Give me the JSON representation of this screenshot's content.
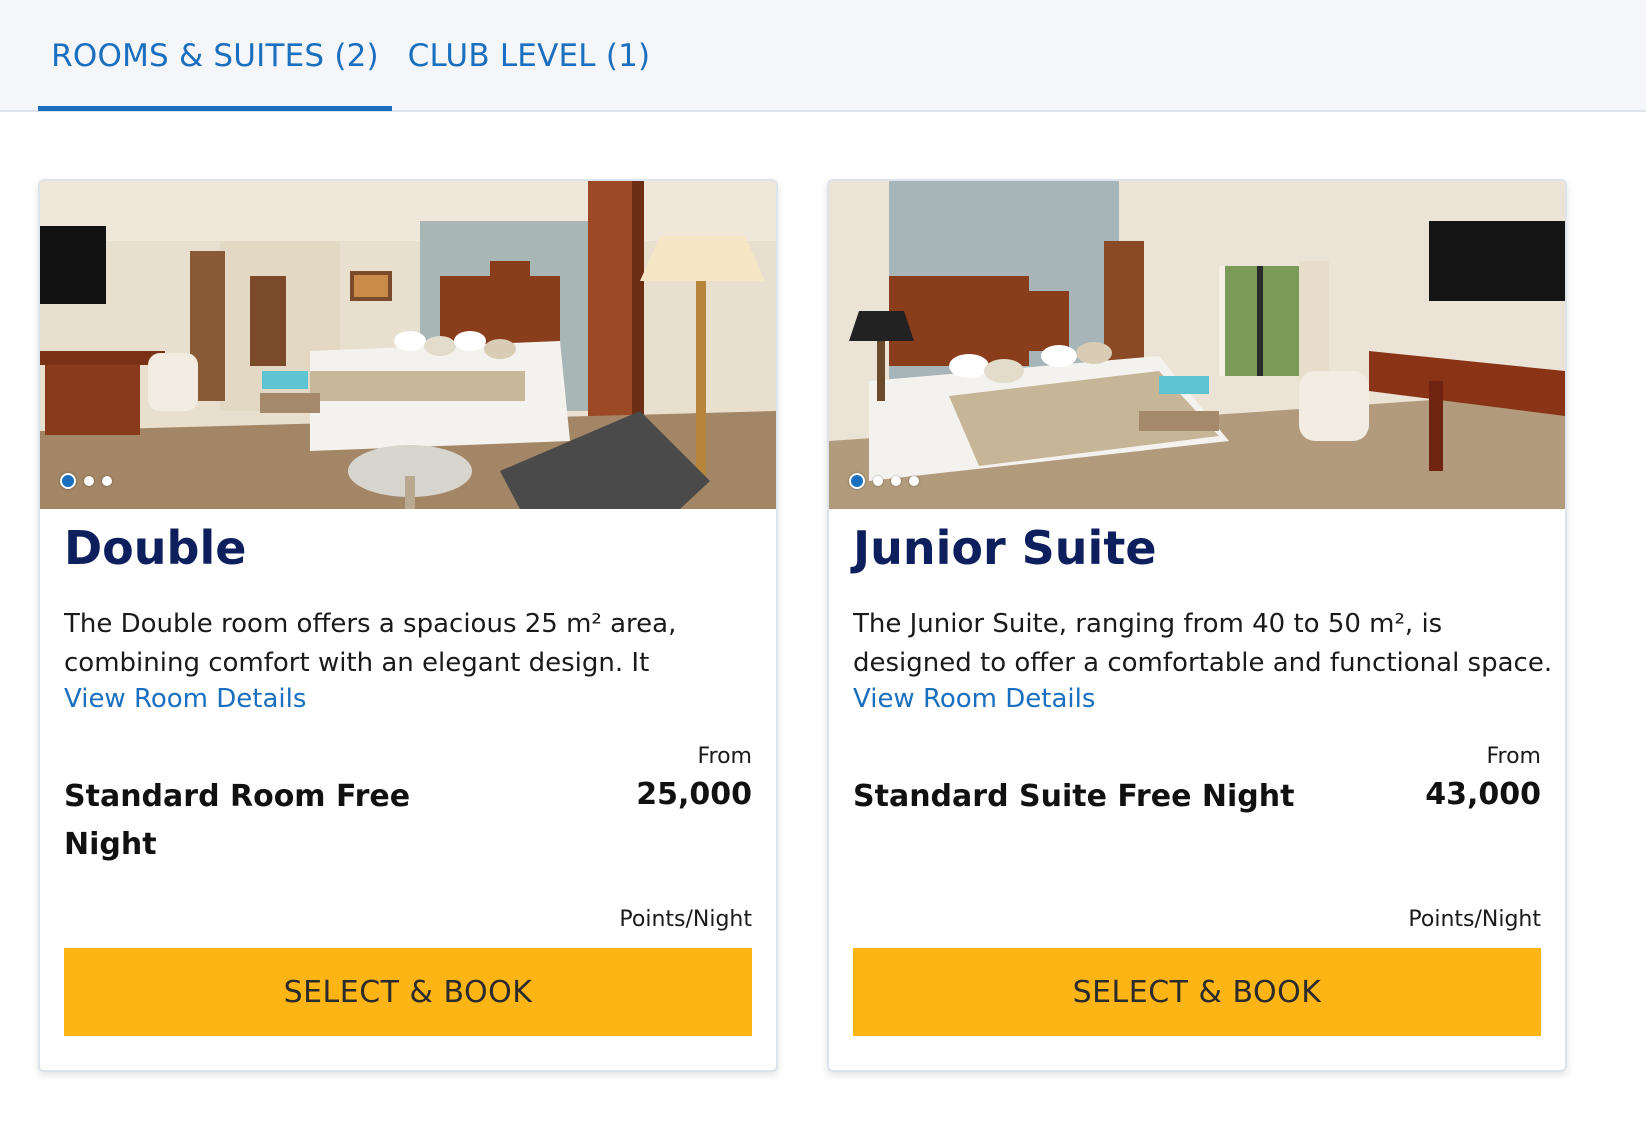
{
  "tabs": [
    {
      "label": "ROOMS & SUITES (2)",
      "active": true
    },
    {
      "label": "CLUB LEVEL (1)",
      "active": false
    }
  ],
  "colors": {
    "accent": "#1a6fbf",
    "title": "#0d1f5c",
    "button": "#fdb515"
  },
  "rooms": [
    {
      "title": "Double",
      "description": "The Double room offers a spacious 25 m² area, combining comfort with an elegant design. It feature...",
      "details_link": "View Room Details",
      "from_label": "From",
      "rate_name": "Standard Room Free Night",
      "points": "25,000",
      "points_unit": "Points/Night",
      "button_label": "SELECT & BOOK",
      "carousel_images": 3,
      "carousel_active": 1
    },
    {
      "title": "Junior Suite",
      "description": "The Junior Suite, ranging from 40 to 50 m², is designed to offer a comfortable and functional space. With an...",
      "details_link": "View Room Details",
      "from_label": "From",
      "rate_name": "Standard Suite Free Night",
      "points": "43,000",
      "points_unit": "Points/Night",
      "button_label": "SELECT & BOOK",
      "carousel_images": 4,
      "carousel_active": 1
    }
  ]
}
